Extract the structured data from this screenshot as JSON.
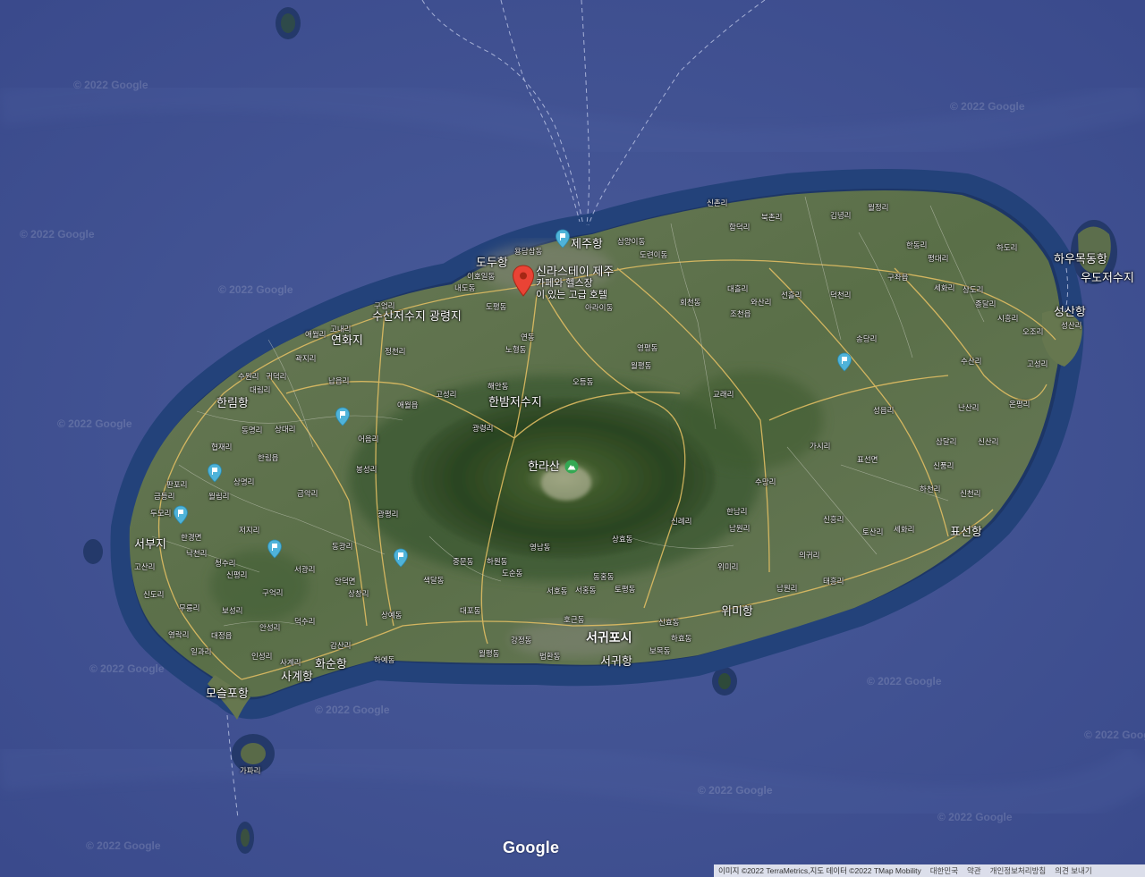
{
  "map": {
    "watermark": "© 2022 Google",
    "attribution": "이미지 ©2022 TerraMetrics,지도 데이터 ©2022 TMap Mobility",
    "footer_links": [
      "대한민국",
      "약관",
      "개인정보처리방침",
      "의견 보내기"
    ],
    "logo": "Google",
    "hotel": {
      "name": "신라스테이 제주",
      "line1": "카페와 헬스장",
      "line2": "이 있는 고급 호텔"
    },
    "peak_label": "한라산",
    "labels": {
      "jeju_port": "제주항",
      "dodu_port": "도두항",
      "hallim_port": "한림항",
      "seobuji": "서부지",
      "moseulpo_port": "모슬포항",
      "gapari": "가파리",
      "hwasun_port": "화순항",
      "sagye_port": "사계항",
      "seogwipo_city": "서귀포시",
      "seogwi_port": "서귀항",
      "wimi_port": "위미항",
      "pyoseon_port": "표선항",
      "seongsan_port": "성산항",
      "haumokdong_port": "하우목동항",
      "udo_reservoir": "우도저수지",
      "hanbam_reservoir": "한밤저수지",
      "yeonhwaji": "연화지",
      "suhsan_reservoir": "수산저수지",
      "gwangryeongji": "광령지",
      "sinchon": "신촌리",
      "bukchon": "북촌리",
      "gimnyeong": "김녕리",
      "woljeong": "월정리",
      "handong": "한동리",
      "hado": "하도리",
      "pyeongdae": "평대리",
      "sehwa": "세화리",
      "sangdo": "상도리",
      "gujwa": "구좌읍",
      "jongdal": "종달리",
      "sihung": "시흥리",
      "ojo": "오조리",
      "seongsanri": "성산리",
      "goseong": "고성리",
      "susan": "수산리",
      "nansan": "난산리",
      "onpyeong": "온평리",
      "seongeup": "성읍리",
      "samdal": "삼달리",
      "sinsan": "신산리",
      "sinpung": "신풍리",
      "sincheon": "신천리",
      "hacheon": "하천리",
      "pyoseon": "표선면",
      "gasi": "가시리",
      "tosan": "토산리",
      "sehwa2": "세화리",
      "sinheung": "신흥리",
      "hallam": "한남리",
      "namwon": "남원리",
      "uigwi": "의귀리",
      "taeheung": "태흥리",
      "wimi": "위미리",
      "namwonri": "남원리",
      "sillye": "신례리",
      "hahyo": "하효동",
      "boga": "보목동",
      "sinhyo": "신효동",
      "topyeong": "토평동",
      "sanghyo": "상효동",
      "yeongnam": "영남동",
      "dosun": "도순동",
      "hawon": "하원동",
      "jungmun": "중문동",
      "daepo": "대포동",
      "gangjeong": "강정동",
      "beophwan": "법환동",
      "wolpyeong": "월평동",
      "hogeun": "호근동",
      "seoho": "서호동",
      "seohong": "서홍동",
      "donghong": "동홍동",
      "saekdal": "색달동",
      "sangye": "상예동",
      "haye": "하예동",
      "gamsan": "감산리",
      "sagye": "사계리",
      "deoksu": "덕수리",
      "anseong": "안성리",
      "inseong": "인성리",
      "boseong": "보성리",
      "daejeong": "대정읍",
      "ilgwa": "일과리",
      "yeongnak": "영락리",
      "mureung": "무릉리",
      "sindo": "신도리",
      "gosan": "고산리",
      "nakcheon": "낙천리",
      "cheongsu": "청수리",
      "sinpyeong": "신평리",
      "gueok": "구억리",
      "seogwang": "서광리",
      "dongwang": "동광리",
      "sangchang": "상창리",
      "andeok": "안덕면",
      "jeoji": "저지리",
      "hangyeong": "한경면",
      "dumo": "두모리",
      "geumdeung": "금등리",
      "panpo": "판포리",
      "wollim": "월림리",
      "hyeopjae": "협재리",
      "sangmyeong": "상명리",
      "hallimeup": "한림읍",
      "dongmyeong": "동명리",
      "sangdae": "상대리",
      "daerim": "대림리",
      "suwon": "수원리",
      "gwideok": "귀덕리",
      "gwakji": "곽지리",
      "aewol": "애월리",
      "gonae": "고내리",
      "guyeom": "구엄리",
      "napeup": "납읍리",
      "eoeum": "어음리",
      "bongseong": "봉성리",
      "geumak": "금악리",
      "gwangpyeong": "광평리",
      "sangga": "상가리",
      "aewoleup": "애월읍",
      "jeongcheon": "정천리",
      "goseongri": "고성리",
      "gwangryeong": "광령리",
      "haean": "해안동",
      "nohyeong": "노형동",
      "yeon": "연동",
      "odeung": "오등동",
      "ara": "아라이동",
      "yongdam": "용담삼동",
      "ieho": "이호일동",
      "naedo": "내도동",
      "dopyeong": "도평동",
      "samyang": "삼양이동",
      "dongyeon": "도련이동",
      "bonggae": "봉개동",
      "yeongpyeong": "영평동",
      "wolpyeong2": "월평동",
      "hoecheon": "회천동",
      "daeheul": "대흘리",
      "hamdeok": "함덕리",
      "jocheon": "조천읍",
      "wasan": "와산리",
      "seonheul": "선흘리",
      "deokcheon": "덕천리",
      "songdang": "송당리",
      "gyorae": "교래리",
      "sumang": "수망리",
      "yongdeung": "영평동"
    }
  }
}
